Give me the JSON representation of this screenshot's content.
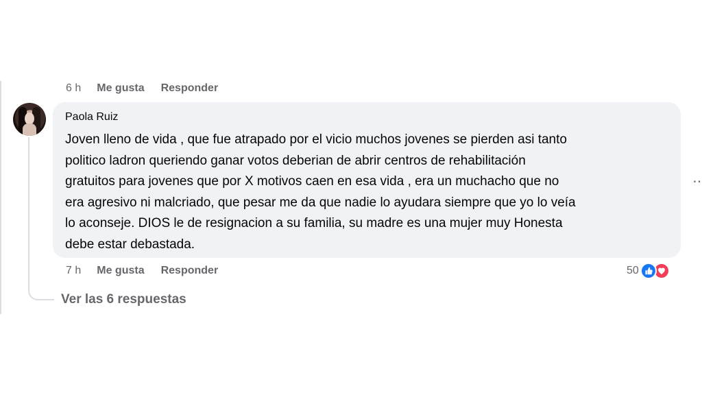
{
  "previous_comment": {
    "time": "6 h",
    "like_label": "Me gusta",
    "reply_label": "Responder"
  },
  "comment": {
    "author": "Paola Ruiz",
    "text": "Joven lleno de vida , que fue atrapado por el vicio muchos jovenes se pierden asi tanto\npolitico ladron queriendo ganar votos deberian de abrir centros de rehabilitación\ngratuitos para jovenes que por X motivos caen en esa vida , era un muchacho que no\nera agresivo ni malcriado, que pesar me da que nadie lo ayudara siempre que yo lo veía\nlo aconseje. DIOS le de resignacion a su familia, su madre es una mujer muy Honesta\ndebe estar debastada.",
    "time": "7 h",
    "like_label": "Me gusta",
    "reply_label": "Responder",
    "reaction_count": "50",
    "reaction_icons": [
      "like-icon",
      "love-icon"
    ],
    "more_icon": "more-options-icon",
    "view_replies_label": "Ver las 6 respuestas"
  },
  "colors": {
    "bubble_bg": "#f0f2f5",
    "meta_text": "#65676b",
    "like_blue": "#1877f2",
    "love_red": "#f33e58"
  }
}
